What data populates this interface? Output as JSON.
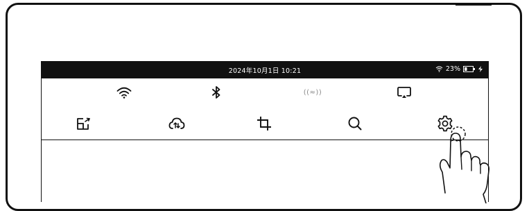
{
  "status_bar": {
    "datetime": "2024年10月1日 10:21",
    "battery_percent": "23%",
    "icons": [
      "wifi-icon",
      "battery-icon",
      "charging-icon"
    ]
  },
  "quick_settings": {
    "row1": [
      {
        "name": "wifi-toggle",
        "icon": "wifi-icon"
      },
      {
        "name": "bluetooth-toggle",
        "icon": "bluetooth-icon"
      },
      {
        "name": "nfc-toggle",
        "icon": "nfc-icon",
        "label": "((≈))"
      },
      {
        "name": "screen-cast-toggle",
        "icon": "screen-cast-icon"
      }
    ],
    "row2": [
      {
        "name": "file-transfer-button",
        "icon": "file-transfer-icon"
      },
      {
        "name": "cloud-sync-button",
        "icon": "cloud-sync-icon"
      },
      {
        "name": "screenshot-crop-button",
        "icon": "crop-icon"
      },
      {
        "name": "search-button",
        "icon": "search-icon"
      },
      {
        "name": "settings-button",
        "icon": "gear-icon"
      }
    ]
  },
  "colors": {
    "status_bar_bg": "#111111",
    "foreground": "#111111",
    "disabled": "#888888"
  }
}
